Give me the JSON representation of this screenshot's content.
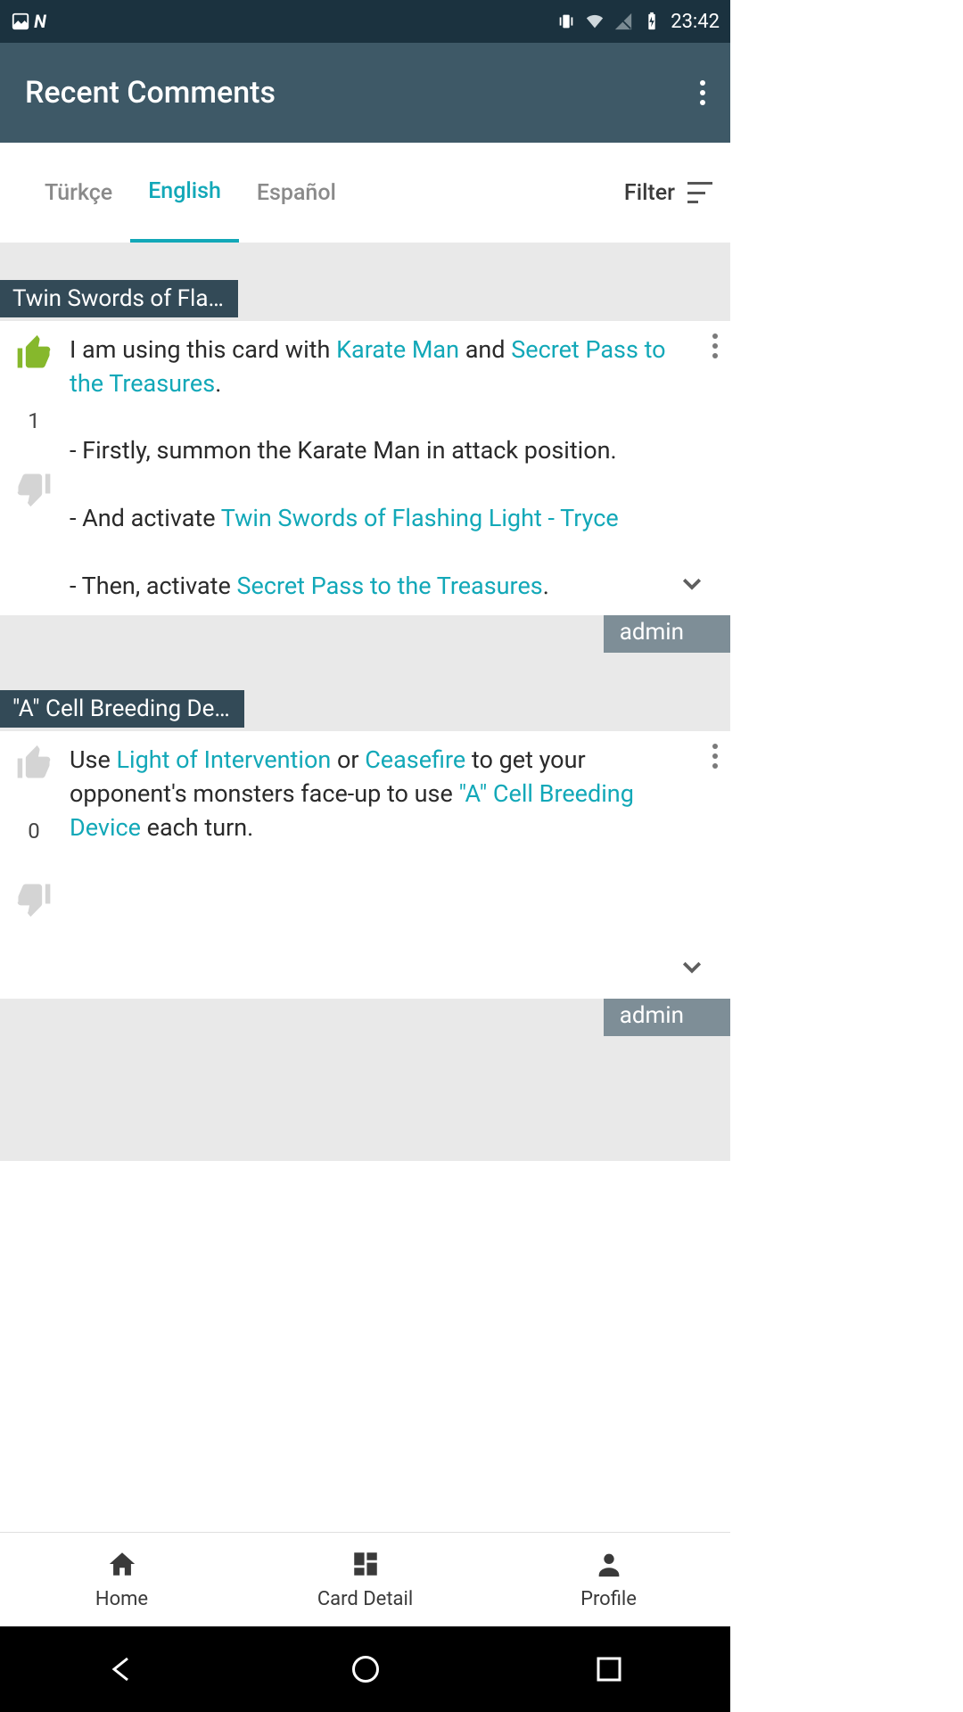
{
  "statusbar": {
    "time": "23:42"
  },
  "appbar": {
    "title": "Recent Comments"
  },
  "tabs": {
    "lang0": "Türkçe",
    "lang1": "English",
    "lang2": "Español",
    "filter_label": "Filter"
  },
  "comment1": {
    "card_title": "Twin Swords of Fla…",
    "vote_count": "1",
    "text_pre": "I am using this card with ",
    "link1": "Karate Man",
    "text_mid1": " and ",
    "link2": "Secret Pass to the Treasures",
    "text_post1": ".",
    "line2": "- Firstly,  summon the Karate Man in attack position.",
    "line3_pre": "- And activate ",
    "line3_link": "Twin Swords of Flashing Light - Tryce",
    "line4_pre": "- Then, activate ",
    "line4_link": "Secret Pass to the Treasures",
    "line4_post": ".",
    "author": "admin"
  },
  "comment2": {
    "card_title": "\"A\" Cell Breeding De…",
    "vote_count": "0",
    "t1": "Use ",
    "l1": "Light of Intervention",
    "t2": "  or ",
    "l2": "Ceasefire",
    "t3": " to get your opponent's monsters face-up to use ",
    "l3": "\"A\" Cell Breeding Device",
    "t4": " each turn.",
    "author": "admin"
  },
  "bottomnav": {
    "home": "Home",
    "card": "Card Detail",
    "profile": "Profile"
  }
}
